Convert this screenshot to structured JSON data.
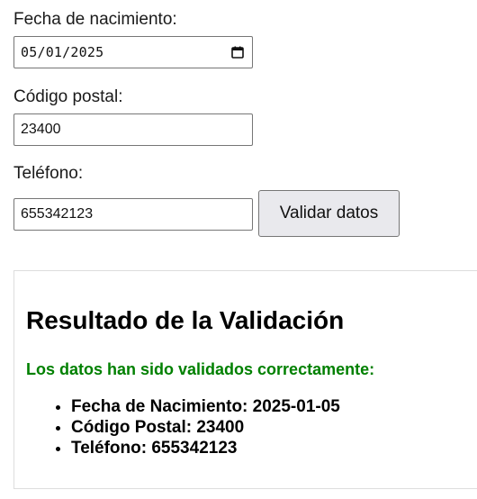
{
  "form": {
    "birthdate": {
      "label": "Fecha de nacimiento:",
      "value": "05/01/2025"
    },
    "postal_code": {
      "label": "Código postal:",
      "value": "23400"
    },
    "phone": {
      "label": "Teléfono:",
      "value": "655342123"
    },
    "submit_label": "Validar datos"
  },
  "result": {
    "title": "Resultado de la Validación",
    "message": "Los datos han sido validados correctamente:",
    "message_color": "#008000",
    "items": [
      "Fecha de Nacimiento: 2025-01-05",
      "Código Postal: 23400",
      "Teléfono: 655342123"
    ]
  }
}
